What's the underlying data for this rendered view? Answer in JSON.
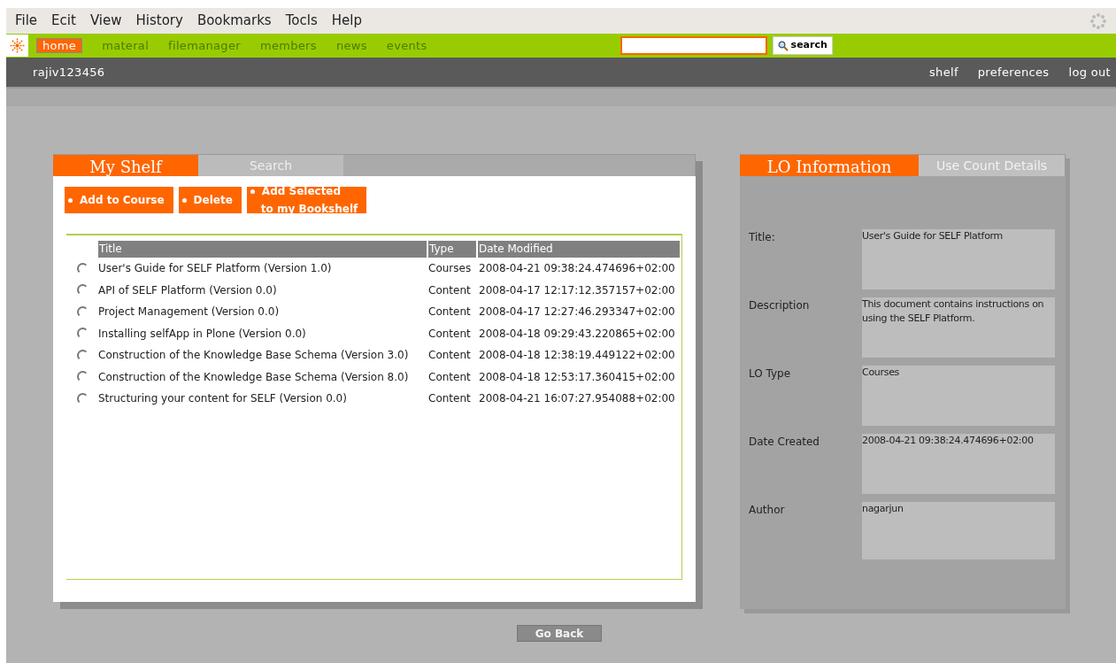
{
  "menu": [
    "File",
    "Ecit",
    "View",
    "History",
    "Bookmarks",
    "Tocls",
    "Help"
  ],
  "nav": [
    {
      "label": "home",
      "selected": true
    },
    {
      "label": "materal",
      "selected": false
    },
    {
      "label": "filemanager",
      "selected": false
    },
    {
      "label": "members",
      "selected": false
    },
    {
      "label": "news",
      "selected": false
    },
    {
      "label": "events",
      "selected": false
    }
  ],
  "search": {
    "button": "search"
  },
  "user": "rajiv123456",
  "user_links": [
    "shelf",
    "preferences",
    "log out"
  ],
  "left_tabs": [
    {
      "label": "My Shelf",
      "selected": true
    },
    {
      "label": "Search",
      "selected": false
    }
  ],
  "actions": [
    {
      "lines": [
        "Add to Course"
      ]
    },
    {
      "lines": [
        "Delete"
      ]
    },
    {
      "lines": [
        "Add Selected",
        "to my Bookshelf"
      ]
    }
  ],
  "table": {
    "columns": [
      "Title",
      "Type",
      "Date Modified"
    ],
    "rows": [
      {
        "selected": false,
        "cells": [
          "User's Guide for SELF Platform (Version 1.0)",
          "Courses",
          "2008-04-21 09:38:24.474696+02:00"
        ]
      },
      {
        "selected": false,
        "cells": [
          "API of SELF Platform (Version 0.0)",
          "Content",
          "2008-04-17 12:17:12.357157+02:00"
        ]
      },
      {
        "selected": false,
        "cells": [
          "Project Management (Version 0.0)",
          "Content",
          "2008-04-17 12:27:46.293347+02:00"
        ]
      },
      {
        "selected": false,
        "cells": [
          "Installing selfApp in Plone (Version 0.0)",
          "Content",
          "2008-04-18 09:29:43.220865+02:00"
        ]
      },
      {
        "selected": false,
        "cells": [
          "Construction of the Knowledge Base Schema (Version 3.0)",
          "Content",
          "2008-04-18 12:38:19.449122+02:00"
        ]
      },
      {
        "selected": false,
        "cells": [
          "Construction of the Knowledge Base Schema (Version 8.0)",
          "Content",
          "2008-04-18 12:53:17.360415+02:00"
        ]
      },
      {
        "selected": false,
        "cells": [
          "Structuring your content for SELF (Version 0.0)",
          "Content",
          "2008-04-21 16:07:27.954088+02:00"
        ]
      }
    ]
  },
  "right_tabs": [
    {
      "label": "LO Information",
      "selected": true
    },
    {
      "label": "Use Count Details",
      "selected": false
    }
  ],
  "info": [
    {
      "label": "Title:",
      "value": "User's Guide for SELF Platform"
    },
    {
      "label": "Description",
      "value": "This document contains instructions on using the SELF Platform."
    },
    {
      "label": "LO Type",
      "value": "Courses"
    },
    {
      "label": "Date Created",
      "value": "2008-04-21 09:38:24.474696+02:00"
    },
    {
      "label": "Author",
      "value": "nagarjun"
    }
  ],
  "go_back": "Go Back"
}
